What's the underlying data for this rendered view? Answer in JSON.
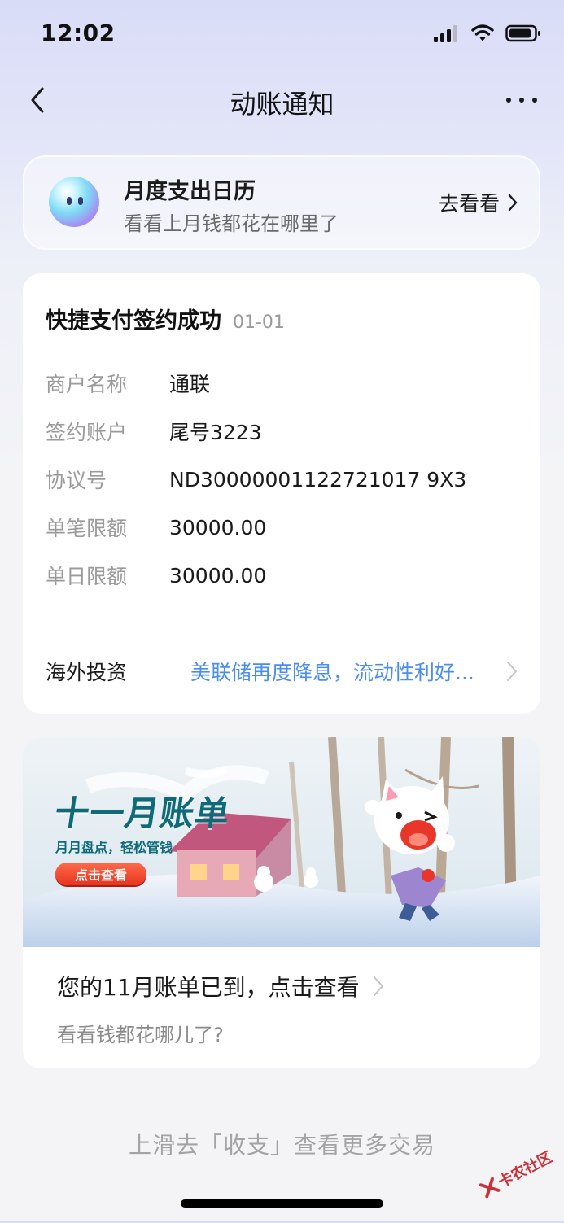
{
  "status_bar": {
    "time": "12:02"
  },
  "nav": {
    "title": "动账通知",
    "back_icon": "chevron-left-icon",
    "more_icon": "more-icon"
  },
  "promo": {
    "title": "月度支出日历",
    "subtitle": "看看上月钱都花在哪里了",
    "action_label": "去看看"
  },
  "notice": {
    "title": "快捷支付签约成功",
    "date": "01-01",
    "details": [
      {
        "label": "商户名称",
        "value": "通联"
      },
      {
        "label": "签约账户",
        "value": "尾号3223"
      },
      {
        "label": "协议号",
        "value": "ND30000001122721017 9X3"
      },
      {
        "label": "单笔限额",
        "value": "30000.00"
      },
      {
        "label": "单日限额",
        "value": "30000.00"
      }
    ],
    "invest": {
      "label": "海外投资",
      "link_text": "美联储再度降息，流动性利好..."
    }
  },
  "bill": {
    "banner": {
      "title": "十一月账单",
      "subtitle": "月月盘点，轻松管钱",
      "button_label": "点击查看"
    },
    "title": "您的11月账单已到，点击查看",
    "subtitle": "看看钱都花哪儿了?"
  },
  "footer": {
    "hint": "上滑去「收支」查看更多交易"
  },
  "watermark": {
    "text": "卡农社区"
  },
  "colors": {
    "accent_link": "#4a8ef0",
    "banner_red": "#e8331f",
    "banner_teal": "#0e6a79"
  }
}
